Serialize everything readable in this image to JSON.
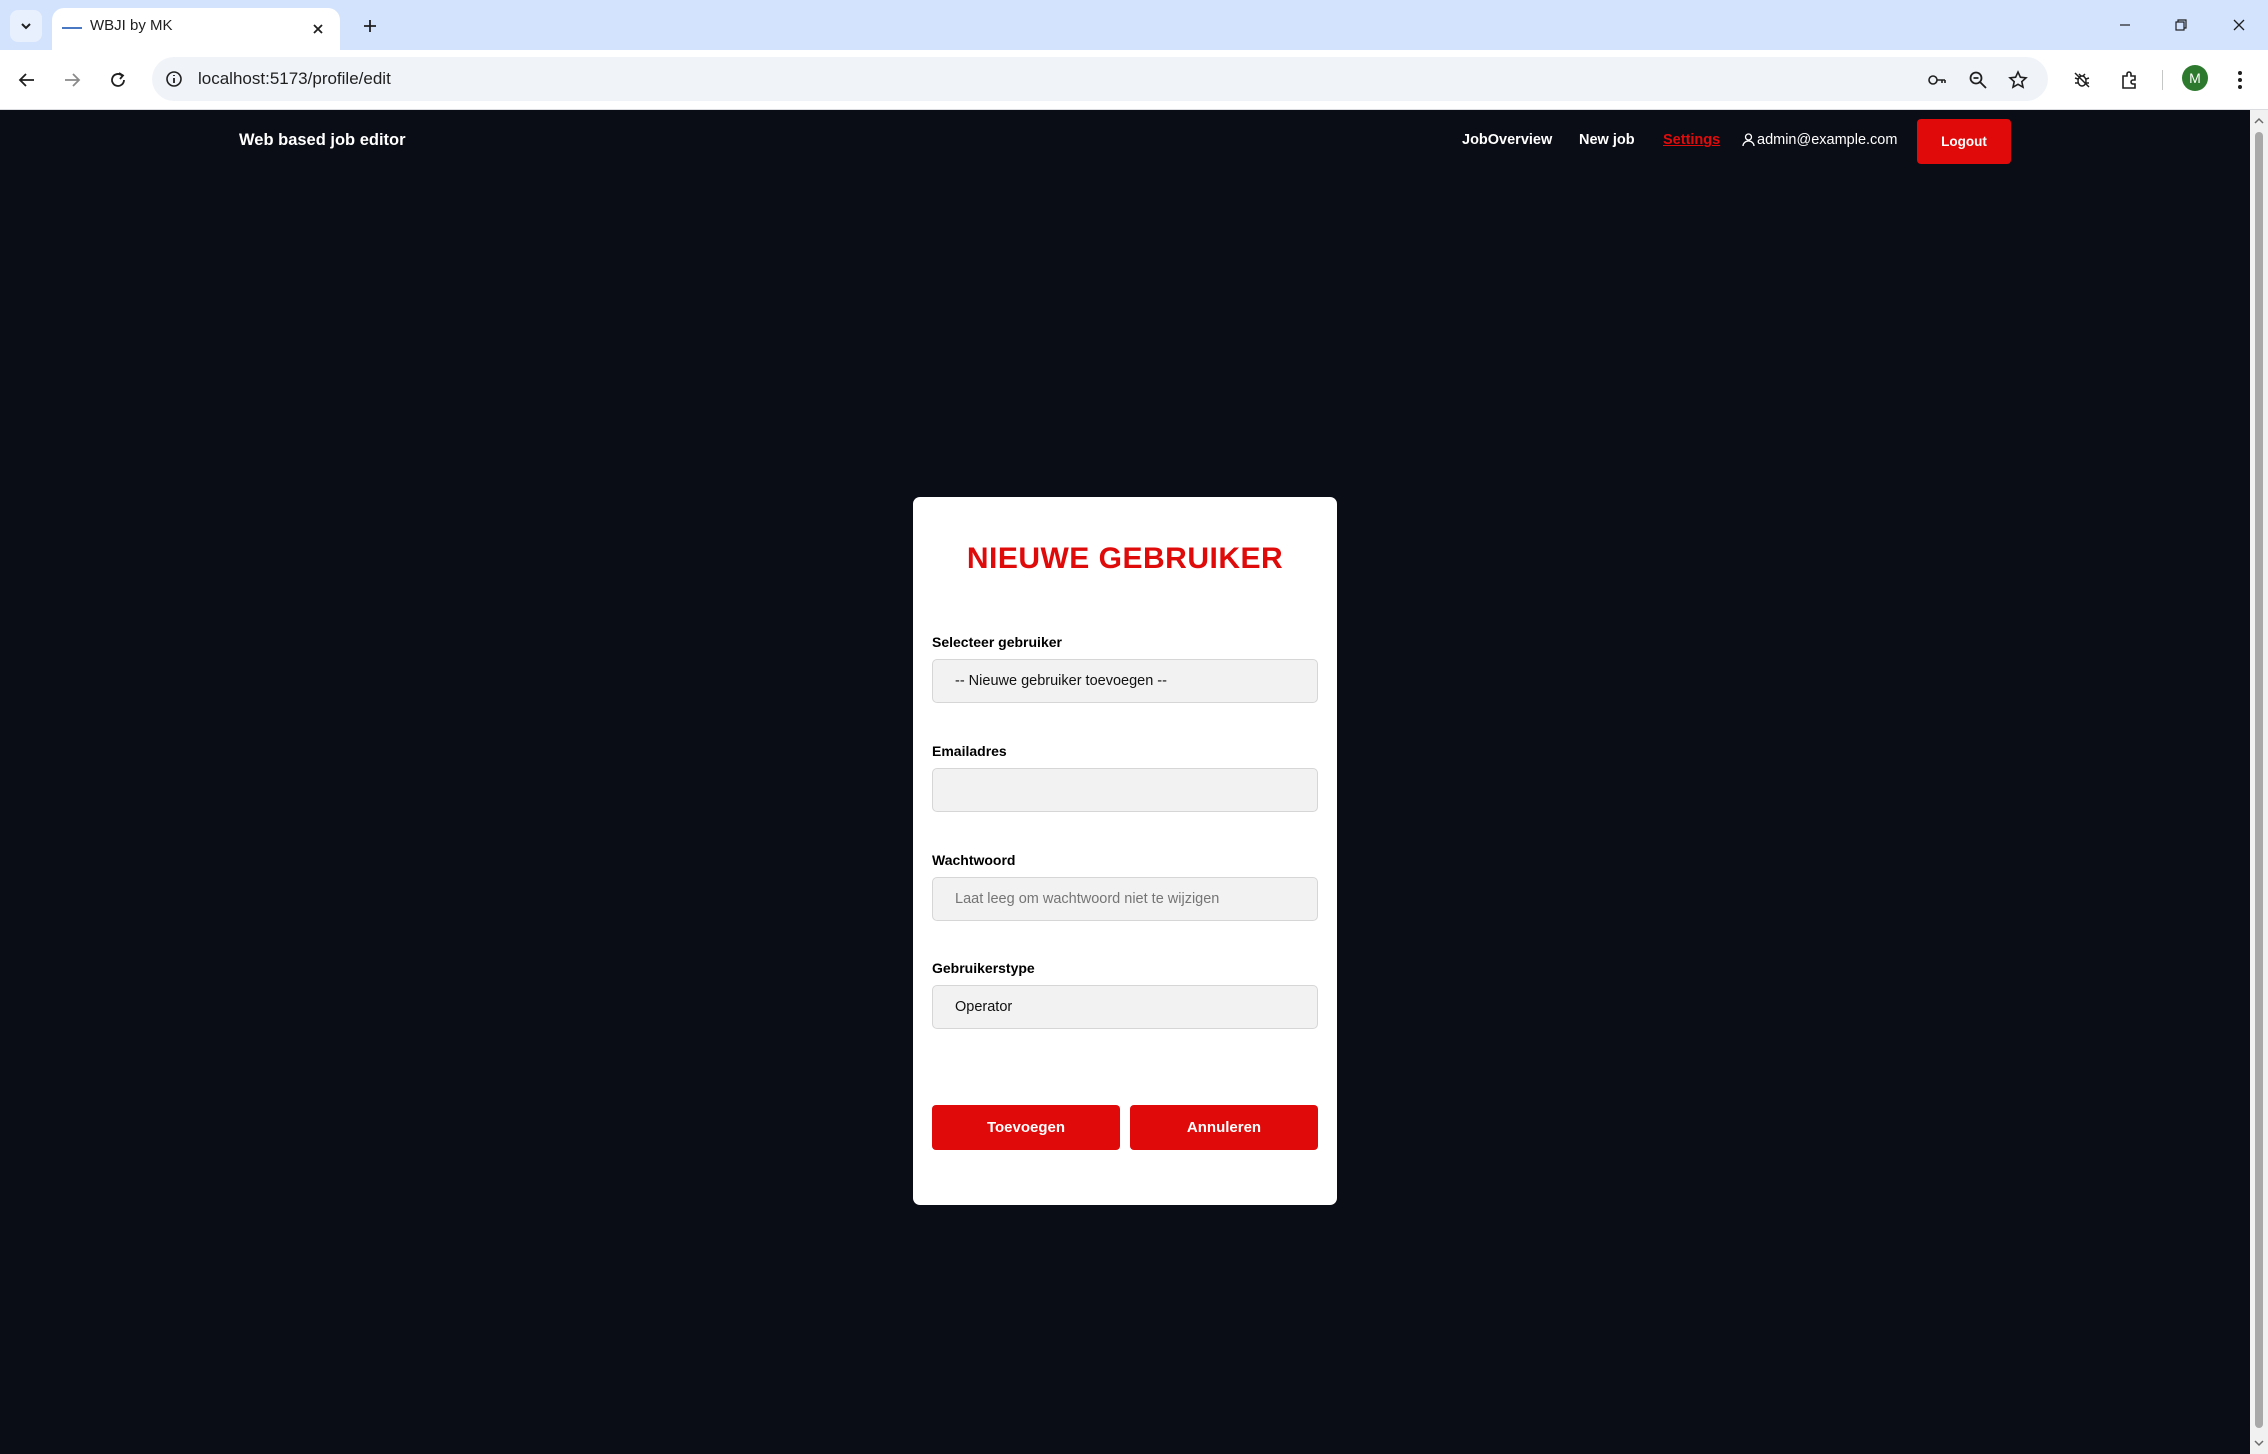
{
  "browser": {
    "tab_title": "WBJI by MK",
    "url": "localhost:5173/profile/edit",
    "profile_initial": "M"
  },
  "app": {
    "brand": "Web based job editor",
    "nav": {
      "job_overview": "JobOverview",
      "new_job": "New job",
      "settings": "Settings",
      "user_email": "admin@example.com",
      "logout": "Logout"
    },
    "colors": {
      "accent": "#e00a0a",
      "background": "#0b0d16",
      "card": "#ffffff"
    }
  },
  "form": {
    "title": "NIEUWE GEBRUIKER",
    "select_user": {
      "label": "Selecteer gebruiker",
      "value": "-- Nieuwe gebruiker toevoegen --"
    },
    "email": {
      "label": "Emailadres",
      "value": ""
    },
    "password": {
      "label": "Wachtwoord",
      "placeholder": "Laat leeg om wachtwoord niet te wijzigen"
    },
    "user_type": {
      "label": "Gebruikerstype",
      "value": "Operator"
    },
    "submit": "Toevoegen",
    "cancel": "Annuleren"
  }
}
